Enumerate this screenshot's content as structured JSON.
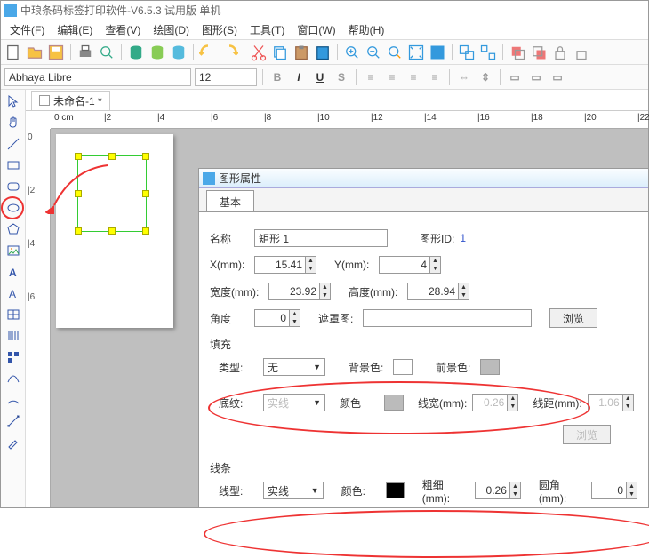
{
  "title": "中琅条码标签打印软件-V6.5.3 试用版 单机",
  "menus": [
    "文件(F)",
    "编辑(E)",
    "查看(V)",
    "绘图(D)",
    "图形(S)",
    "工具(T)",
    "窗口(W)",
    "帮助(H)"
  ],
  "font_combo": "Abhaya Libre",
  "size_combo": "12",
  "doc_tab": "未命名-1 *",
  "ruler_h": [
    "0 cm",
    "|2",
    "|4",
    "|6",
    "|8",
    "|10",
    "|12",
    "|14",
    "|16",
    "|18",
    "|20",
    "|22"
  ],
  "ruler_v": [
    "0",
    "|2",
    "|4",
    "|6"
  ],
  "props": {
    "title": "图形属性",
    "tab": "基本",
    "name_lbl": "名称",
    "name_val": "矩形 1",
    "id_lbl": "图形ID:",
    "id_val": "1",
    "x_lbl": "X(mm):",
    "x_val": "15.41",
    "y_lbl": "Y(mm):",
    "y_val": "4",
    "w_lbl": "宽度(mm):",
    "w_val": "23.92",
    "h_lbl": "高度(mm):",
    "h_val": "28.94",
    "ang_lbl": "角度",
    "ang_val": "0",
    "mask_lbl": "遮罩图:",
    "browse": "浏览",
    "fill_group": "填充",
    "type_lbl": "类型:",
    "type_val": "无",
    "bg_lbl": "背景色:",
    "fg_lbl": "前景色:",
    "pattern_lbl": "底纹:",
    "pattern_val": "实线",
    "pcolor_lbl": "颜色",
    "lw_lbl": "线宽(mm):",
    "lw_val": "0.26",
    "ld_lbl": "线距(mm):",
    "ld_val": "1.06",
    "line_group": "线条",
    "ltype_lbl": "线型:",
    "ltype_val": "实线",
    "lcolor_lbl": "颜色:",
    "thick_lbl": "粗细(mm):",
    "thick_val": "0.26",
    "round_lbl": "圆角(mm):",
    "round_val": "0"
  }
}
